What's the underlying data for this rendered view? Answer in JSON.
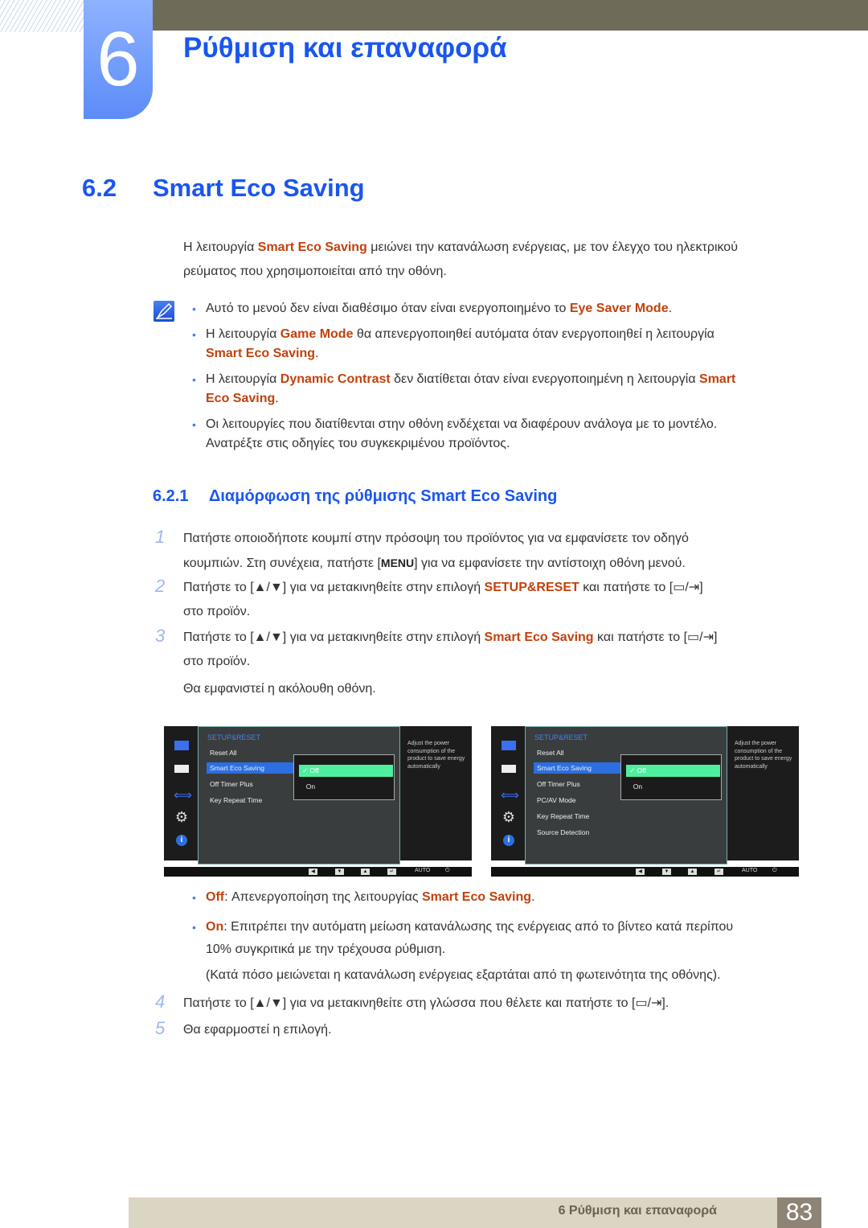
{
  "chapter": {
    "number": "6",
    "title": "Ρύθμιση και επαναφορά"
  },
  "section": {
    "number": "6.2",
    "title": "Smart Eco Saving"
  },
  "intro": {
    "pre": "Η λειτουργία ",
    "hl": "Smart Eco Saving",
    "post": " μειώνει την κατανάλωση ενέργειας, με τον έλεγχο του ηλεκτρικού",
    "line2": "ρεύματος που χρησιμοποιείται από την οθόνη."
  },
  "notes": [
    {
      "pre": "Αυτό το μενού δεν είναι διαθέσιμο όταν είναι ενεργοποιημένο το ",
      "hl": "Eye Saver Mode",
      "post": "."
    },
    {
      "pre": "Η λειτουργία ",
      "hl": "Game Mode",
      "post": " θα απενεργοποιηθεί αυτόματα όταν ενεργοποιηθεί η λειτουργία",
      "hl2": "Smart Eco Saving",
      "post2": "."
    },
    {
      "pre": "Η λειτουργία ",
      "hl": "Dynamic Contrast",
      "post": " δεν διατίθεται όταν είναι ενεργοποιημένη η λειτουργία ",
      "hl2a": "Smart",
      "hl2": "Eco Saving",
      "post2": "."
    },
    {
      "line1": "Οι λειτουργίες που διατίθενται στην οθόνη ενδέχεται να διαφέρουν ανάλογα με το μοντέλο.",
      "line2": "Ανατρέξτε στις οδηγίες του συγκεκριμένου προϊόντος."
    }
  ],
  "subsection": {
    "number": "6.2.1",
    "title": "Διαμόρφωση της ρύθμισης Smart Eco Saving"
  },
  "steps": [
    {
      "num": "1",
      "line1": "Πατήστε οποιοδήποτε κουμπί στην πρόσοψη του προϊόντος για να εμφανίσετε τον οδηγό",
      "line2a": "κουμπιών. Στη συνέχεια, πατήστε [",
      "key": "MENU",
      "line2b": "] για να εμφανίσετε την αντίστοιχη οθόνη μενού."
    },
    {
      "num": "2",
      "pre": "Πατήστε το [▲/▼] για να μετακινηθείτε στην επιλογή ",
      "hl": "SETUP&RESET",
      "post": " και πατήστε το [▭/⇥]",
      "line2": "στο προϊόν."
    },
    {
      "num": "3",
      "pre": "Πατήστε το [▲/▼] για να μετακινηθείτε στην επιλογή ",
      "hl": "Smart Eco Saving",
      "post": " και πατήστε το [▭/⇥]",
      "line2": "στο προϊόν.",
      "line3": "Θα εμφανιστεί η ακόλουθη οθόνη."
    },
    {
      "num": "4",
      "text": "Πατήστε το [▲/▼] για να μετακινηθείτε στη γλώσσα που θέλετε και πατήστε το [▭/⇥]."
    },
    {
      "num": "5",
      "text": "Θα εφαρμοστεί η επιλογή."
    }
  ],
  "osd_screens": [
    {
      "menu_title": "SETUP&RESET",
      "items": [
        "Reset All",
        "Smart Eco Saving",
        "Off Timer Plus",
        "Key Repeat Time"
      ],
      "selected_item": "Smart Eco Saving",
      "options": [
        "Off",
        "On"
      ],
      "selected_option": "Off",
      "description": "Adjust the power consumption of the product to save energy automatically",
      "bottom_buttons": [
        "◀",
        "▼",
        "▲",
        "↵",
        "AUTO",
        "⏻"
      ]
    },
    {
      "menu_title": "SETUP&RESET",
      "items": [
        "Reset All",
        "Smart Eco Saving",
        "Off Timer Plus",
        "PC/AV Mode",
        "Key Repeat Time",
        "Source Detection"
      ],
      "selected_item": "Smart Eco Saving",
      "options": [
        "Off",
        "On"
      ],
      "selected_option": "Off",
      "description": "Adjust the power consumption of the product to save energy automatically",
      "bottom_buttons": [
        "◀",
        "▼",
        "▲",
        "↵",
        "AUTO",
        "⏻"
      ]
    }
  ],
  "options_desc": [
    {
      "label": "Off",
      "pre": ": Απενεργοποίηση της λειτουργίας ",
      "hl": "Smart Eco Saving",
      "post": "."
    },
    {
      "label": "On",
      "line1": ": Επιτρέπει την αυτόματη μείωση κατανάλωσης της ενέργειας από το βίντεο κατά περίπου",
      "line2": "10% συγκριτικά με την τρέχουσα ρύθμιση.",
      "line3": "(Κατά πόσο μειώνεται η κατανάλωση ενέργειας εξαρτάται από τη φωτεινότητα της οθόνης)."
    }
  ],
  "footer": {
    "chapter_label": "6 Ρύθμιση και επαναφορά",
    "page": "83"
  },
  "colors": {
    "heading_blue": "#1a56ee",
    "highlight_orange": "#c2410c",
    "footer_bg": "#dbd5c3"
  }
}
